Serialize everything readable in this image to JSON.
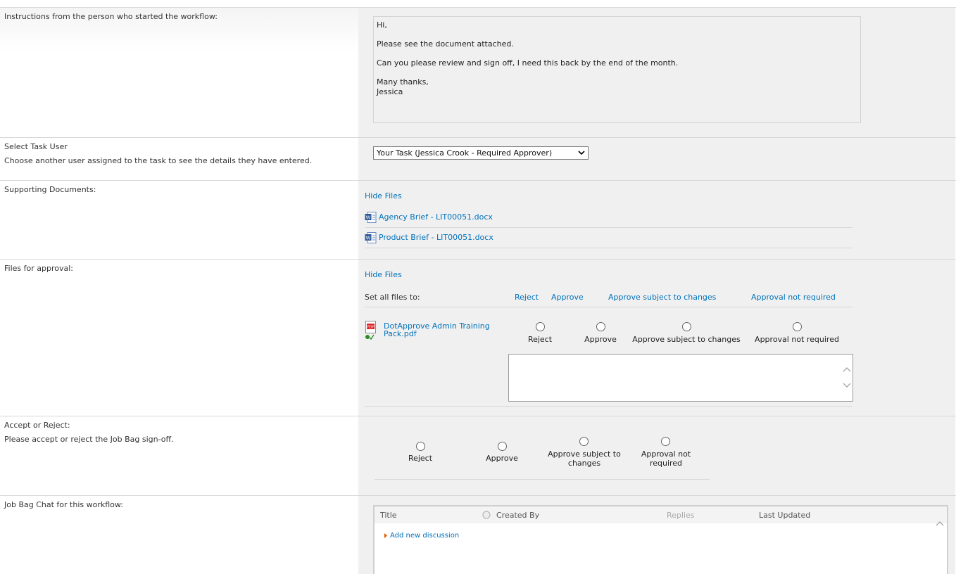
{
  "instructions": {
    "label": "Instructions from the person who started the workflow:",
    "greeting": "Hi,",
    "line1": "Please see the document attached.",
    "line2": "Can you please review and sign off, I need this back by the end of the month.",
    "closing": "Many thanks,",
    "signature": "Jessica"
  },
  "task_user": {
    "label": "Select Task User",
    "description": "Choose another user assigned to the task to see the details they have entered.",
    "selected": "Your Task (Jessica Crook - Required Approver)"
  },
  "supporting_documents": {
    "label": "Supporting Documents:",
    "hide_files": "Hide Files",
    "files": [
      {
        "name": "Agency Brief - LIT00051.docx",
        "icon": "word-doc-icon"
      },
      {
        "name": "Product Brief - LIT00051.docx",
        "icon": "word-doc-icon"
      }
    ]
  },
  "files_for_approval": {
    "label": "Files for approval:",
    "hide_files": "Hide Files",
    "set_all_label": "Set all files to:",
    "set_all_options": [
      "Reject",
      "Approve",
      "Approve subject to changes",
      "Approval not required"
    ],
    "file": {
      "name": "DotApprove Admin Training Pack.pdf",
      "icon": "pdf-icon"
    },
    "options": [
      "Reject",
      "Approve",
      "Approve subject to changes",
      "Approval not required"
    ]
  },
  "accept_reject": {
    "label": "Accept or Reject:",
    "description": "Please accept or reject the Job Bag sign-off.",
    "options": [
      "Reject",
      "Approve",
      "Approve subject to changes",
      "Approval not required"
    ]
  },
  "chat": {
    "label": "Job Bag Chat for this workflow:",
    "columns": [
      "Title",
      "Created By",
      "Replies",
      "Last Updated"
    ],
    "add_link": "Add new discussion"
  },
  "colors": {
    "link": "#0072bc",
    "panel": "#f0f0f0",
    "border": "#d8d8d8"
  }
}
